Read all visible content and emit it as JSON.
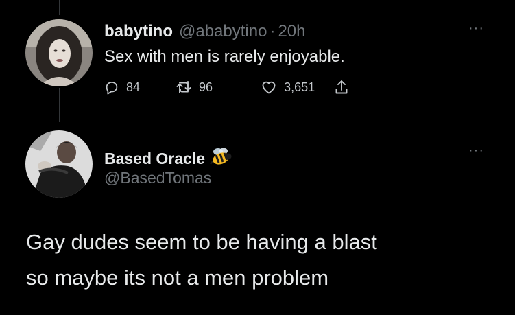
{
  "tweet1": {
    "display_name": "babytino",
    "handle": "@ababytino",
    "separator": "·",
    "time": "20h",
    "text": "Sex with men is rarely enjoyable.",
    "more": "···",
    "actions": {
      "replies": "84",
      "retweets": "96",
      "likes": "3,651"
    }
  },
  "tweet2": {
    "display_name": "Based Oracle",
    "handle": "@BasedTomas",
    "more": "···",
    "text_line1": "Gay dudes seem to be having a blast",
    "text_line2": "so maybe its not a men problem"
  }
}
